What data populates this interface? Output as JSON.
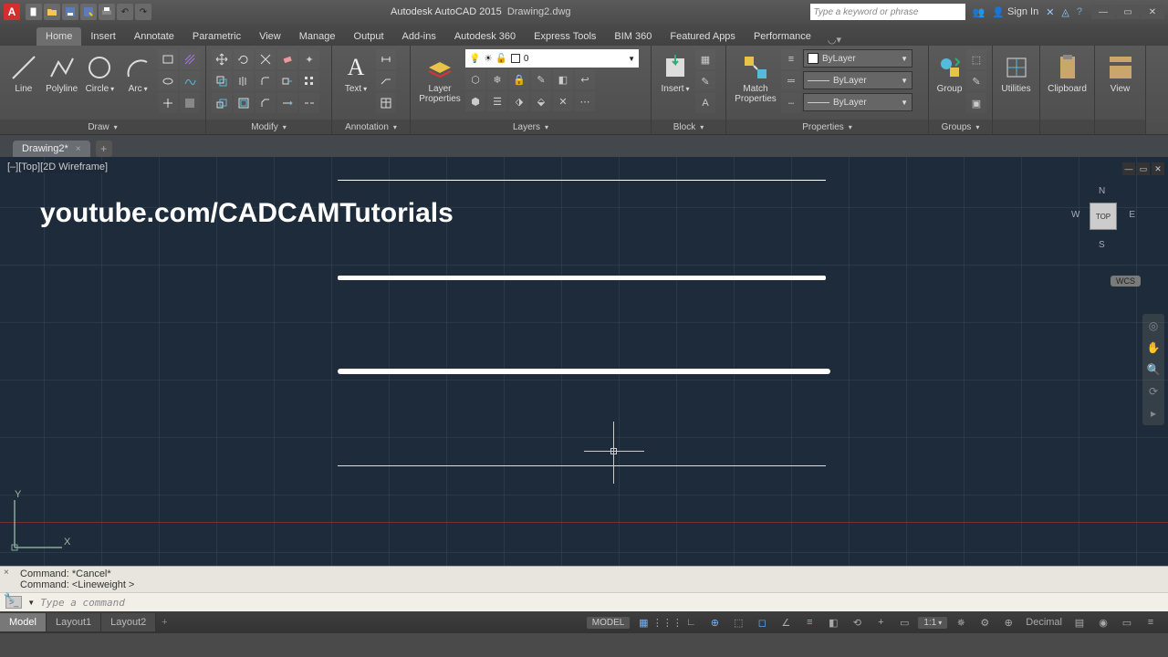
{
  "title": {
    "app": "Autodesk AutoCAD 2015",
    "file": "Drawing2.dwg"
  },
  "search": {
    "placeholder": "Type a keyword or phrase"
  },
  "signin": "Sign In",
  "menutabs": [
    "Home",
    "Insert",
    "Annotate",
    "Parametric",
    "View",
    "Manage",
    "Output",
    "Add-ins",
    "Autodesk 360",
    "Express Tools",
    "BIM 360",
    "Featured Apps",
    "Performance"
  ],
  "active_tab": "Home",
  "panels": {
    "draw": {
      "title": "Draw",
      "buttons": {
        "line": "Line",
        "polyline": "Polyline",
        "circle": "Circle",
        "arc": "Arc"
      }
    },
    "modify": {
      "title": "Modify"
    },
    "annotation": {
      "title": "Annotation",
      "text": "Text"
    },
    "layers": {
      "title": "Layers",
      "props": "Layer\nProperties",
      "current": "0"
    },
    "block": {
      "title": "Block",
      "insert": "Insert"
    },
    "properties": {
      "title": "Properties",
      "match": "Match\nProperties",
      "bylayer1": "ByLayer",
      "bylayer2": "ByLayer",
      "bylayer3": "ByLayer"
    },
    "groups": {
      "title": "Groups",
      "group": "Group"
    },
    "utilities": {
      "title": "Utilities"
    },
    "clipboard": {
      "title": "Clipboard"
    },
    "view": {
      "title": "View"
    }
  },
  "doctab": "Drawing2*",
  "viewport_label": "[–][Top][2D Wireframe]",
  "watermark": "youtube.com/CADCAMTutorials",
  "viewcube": {
    "face": "TOP",
    "n": "N",
    "s": "S",
    "e": "E",
    "w": "W"
  },
  "wcs": "WCS",
  "ucs": {
    "x": "X",
    "y": "Y"
  },
  "cmd": {
    "line1": "Command: *Cancel*",
    "line2": "Command:  <Lineweight >",
    "placeholder": "Type a command"
  },
  "status": {
    "model_tabs": [
      "Model",
      "Layout1",
      "Layout2"
    ],
    "model_badge": "MODEL",
    "scale": "1:1",
    "decimal": "Decimal"
  }
}
